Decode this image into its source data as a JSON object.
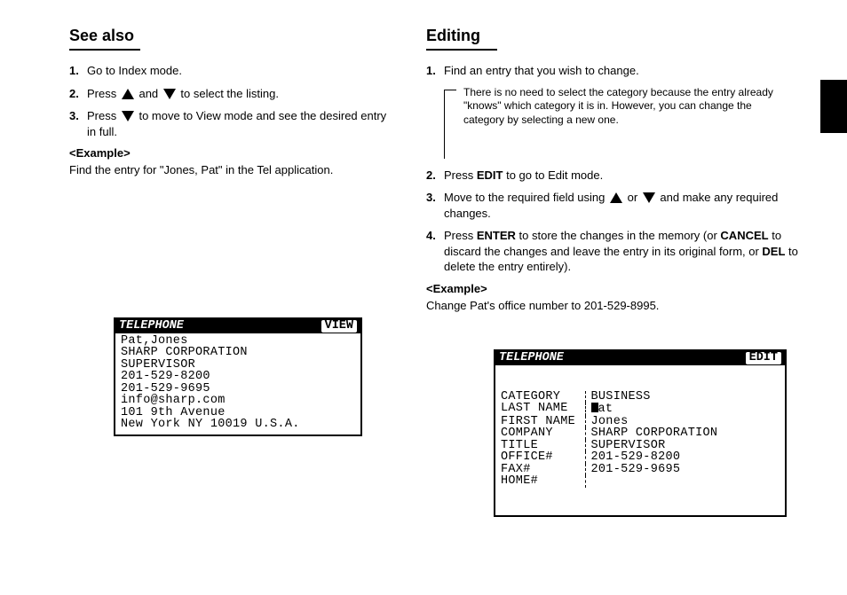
{
  "left": {
    "title": "See also",
    "steps": {
      "s1": "Go to Index mode.",
      "s2a": "Press ",
      "s2b": " and ",
      "s2c": " to select the listing.",
      "s3a": "Press ",
      "s3b": " to move to View mode and see the desired entry in full."
    },
    "ex_label": "<Example>",
    "ex_text": "Find the entry for \"Jones, Pat\" in the Tel application.",
    "lcd": {
      "title": "TELEPHONE",
      "mode": "VIEW",
      "lines": [
        "Pat,Jones",
        "SHARP CORPORATION",
        "SUPERVISOR",
        "201-529-8200",
        "201-529-9695",
        "info@sharp.com",
        "101 9th Avenue",
        "New York NY 10019 U.S.A."
      ]
    }
  },
  "right": {
    "title": "Editing",
    "steps": {
      "s1": "Find an entry that you wish to change.",
      "tip": "There is no need to select the category because the entry already \"knows\" which category it is in. However, you can change the category by selecting a new one.",
      "s2a": "Press ",
      "edit": "EDIT",
      "s2b": " to go to Edit mode.",
      "s3a": "Move to the required field using ",
      "s3b": " or ",
      "s3c": " and make any required changes.",
      "s4a": "Press ",
      "enter": "ENTER",
      "s4b": " to store the changes in the memory (or ",
      "cancel": "CANCEL",
      "s4c": " to discard the changes and leave the entry in its original form, or ",
      "del": "DEL",
      "s4d": " to delete the entry entirely)."
    },
    "ex_label": "<Example>",
    "ex_text": "Change Pat's office number to 201-529-8995.",
    "lcd": {
      "title": "TELEPHONE",
      "mode": "EDIT",
      "rows": [
        {
          "label": "CATEGORY",
          "value": "BUSINESS"
        },
        {
          "label": "LAST NAME",
          "value": "at",
          "cursor": true
        },
        {
          "label": "FIRST NAME",
          "value": "Jones"
        },
        {
          "label": "COMPANY",
          "value": "SHARP CORPORATION"
        },
        {
          "label": "TITLE",
          "value": "SUPERVISOR"
        },
        {
          "label": "OFFICE#",
          "value": "201-529-8200"
        },
        {
          "label": "FAX#",
          "value": "201-529-9695"
        },
        {
          "label": "HOME#",
          "value": ""
        }
      ]
    }
  }
}
